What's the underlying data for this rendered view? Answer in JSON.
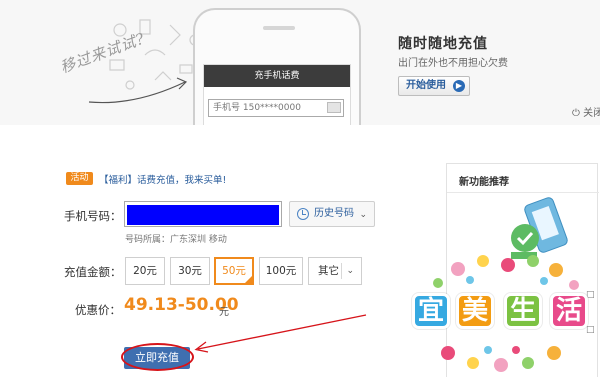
{
  "banner": {
    "try_text": "移过来试试?",
    "phone_title": "充手机话费",
    "phone_placeholder": "手机号 150****0000",
    "promo_title": "随时随地充值",
    "promo_subtitle": "出门在外也不用担心欠费",
    "start_button": "开始使用",
    "close_link": "关闭"
  },
  "activity": {
    "badge": "活动",
    "text": "【福利】话费充值，我来买单!"
  },
  "form": {
    "phone_label": "手机号码：",
    "phone_value": "",
    "history_button": "历史号码",
    "region_info": "号码所属：广东深圳 移动",
    "amount_label": "充值金额：",
    "amounts": [
      "20元",
      "30元",
      "50元",
      "100元"
    ],
    "selected_amount_index": 2,
    "more_button": "其它",
    "price_label": "优惠价：",
    "price_value": "49.13-50.00",
    "price_unit": "元",
    "recharge_button": "立即充值"
  },
  "panel": {
    "title": "新功能推荐"
  },
  "watermark": {
    "chars": [
      "宜",
      "美",
      "生",
      "活"
    ]
  },
  "colors": {
    "accent_orange": "#f08a1c",
    "link_blue": "#2a5d9c",
    "button_blue": "#3f6fb0",
    "annotation_red": "#d6141a",
    "redaction_blue": "#0000ff"
  }
}
